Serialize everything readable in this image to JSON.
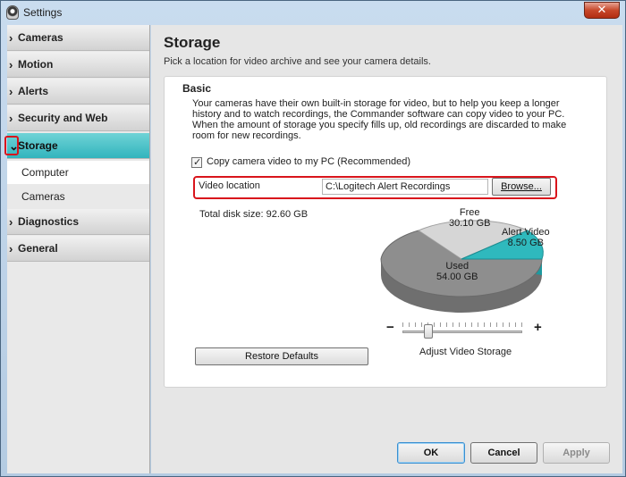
{
  "window": {
    "title": "Settings",
    "close_glyph": "✕"
  },
  "sidebar": {
    "items": [
      {
        "label": "Cameras",
        "chevron": "›"
      },
      {
        "label": "Motion",
        "chevron": "›"
      },
      {
        "label": "Alerts",
        "chevron": "›"
      },
      {
        "label": "Security and Web",
        "chevron": "›"
      },
      {
        "label": "Storage",
        "chevron": "⌄",
        "active": true
      },
      {
        "label": "Diagnostics",
        "chevron": "›"
      },
      {
        "label": "General",
        "chevron": "›"
      }
    ],
    "storage_subitems": [
      {
        "label": "Computer",
        "selected": true
      },
      {
        "label": "Cameras",
        "selected": false
      }
    ]
  },
  "main": {
    "title": "Storage",
    "subtitle": "Pick a location for video archive and see your camera details.",
    "basic_heading": "Basic",
    "description": "Your cameras have their own built-in storage for video, but to help you keep a longer history and to watch recordings, the Commander software can copy video to your PC. When the amount of storage you specify fills up, old recordings are discarded to make room for new recordings.",
    "copy_checkbox": {
      "label": "Copy camera video to my PC (Recommended)",
      "checked": true,
      "glyph": "✓"
    },
    "video_location": {
      "label": "Video location",
      "value": "C:\\Logitech Alert Recordings",
      "browse_label": "Browse..."
    },
    "total_disk": "Total disk size: 92.60 GB",
    "storage_pie": {
      "free_label": "Free",
      "free_value": "30.10 GB",
      "alert_label": "Alert Video",
      "alert_value": "8.50 GB",
      "used_label": "Used",
      "used_value": "54.00 GB"
    },
    "slider": {
      "minus": "−",
      "plus": "+",
      "label": "Adjust Video Storage",
      "level": 0.22
    },
    "restore_label": "Restore Defaults"
  },
  "footer": {
    "ok": "OK",
    "cancel": "Cancel",
    "apply": "Apply"
  },
  "colors": {
    "accent_teal": "#32b4bd",
    "highlight_red": "#d9151c",
    "used_gray": "#8e8e8e",
    "free_light": "#d6d6d6",
    "alert_teal": "#2fb9bd"
  }
}
